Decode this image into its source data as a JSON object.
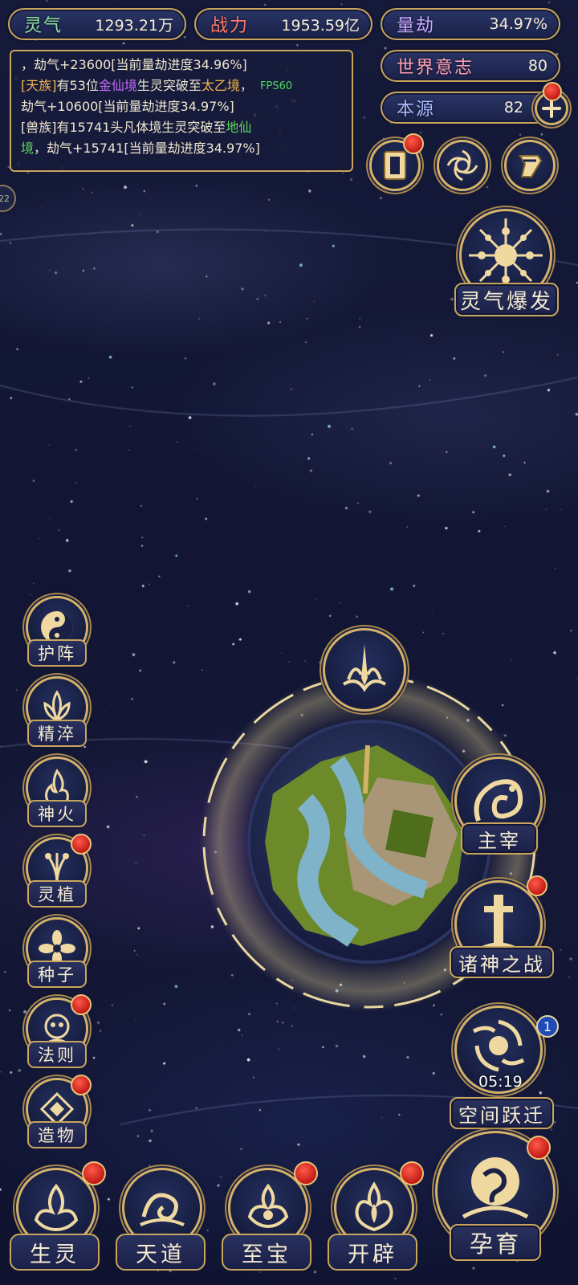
{
  "resources": {
    "qi": {
      "label": "灵气",
      "value": "1293.21万"
    },
    "power": {
      "label": "战力",
      "value": "1953.59亿"
    },
    "kalpa": {
      "label": "量劫",
      "value": "34.97%"
    },
    "world_will": {
      "label": "世界意志",
      "value": "80"
    },
    "origin": {
      "label": "本源",
      "value": "82"
    }
  },
  "log": {
    "line1": "，劫气+23600[当前量劫进度34.96%]",
    "e2_race": "[天族]",
    "e2_a": "有53位",
    "e2_realm": "金仙境",
    "e2_b": "生灵突破至",
    "e2_target": "太乙境",
    "e2_c": "，",
    "e2_d": "劫气+10600[当前量劫进度34.97%]",
    "e3_a": "[兽族]有15741头凡体境生灵突破至",
    "e3_realm": "地仙",
    "e3_realm2": "境",
    "e3_b": "，劫气+15741[当前量劫进度34.97%]",
    "fps": "FPS60",
    "side_tab": "22"
  },
  "top_icons": [
    "card-icon",
    "vortex-icon",
    "scroll-icon"
  ],
  "qi_burst": {
    "label": "灵气爆发"
  },
  "left_menu": [
    {
      "label": "护阵",
      "icon": "yin-yang-icon",
      "dot": false
    },
    {
      "label": "精淬",
      "icon": "lotus-flame-icon",
      "dot": false
    },
    {
      "label": "神火",
      "icon": "divine-fire-icon",
      "dot": false
    },
    {
      "label": "灵植",
      "icon": "spirit-plant-icon",
      "dot": true
    },
    {
      "label": "种子",
      "icon": "seed-flower-icon",
      "dot": false
    },
    {
      "label": "法则",
      "icon": "law-beast-icon",
      "dot": true
    },
    {
      "label": "造物",
      "icon": "creation-diamond-icon",
      "dot": true
    }
  ],
  "right_menu": {
    "ruler": {
      "label": "主宰"
    },
    "gods_war": {
      "label": "诸神之战"
    },
    "space_jump": {
      "label": "空间跃迁",
      "timer": "05:19",
      "badge": "1"
    }
  },
  "bottom_bar": [
    {
      "label": "生灵",
      "icon": "life-icon"
    },
    {
      "label": "天道",
      "icon": "heaven-way-icon"
    },
    {
      "label": "至宝",
      "icon": "treasure-icon"
    },
    {
      "label": "开辟",
      "icon": "creation-flame-icon"
    }
  ],
  "nurture": {
    "label": "孕育"
  },
  "colors": {
    "gold": "#d4b168",
    "panel": "#1a2148",
    "dot": "#c21b16",
    "water": "#7fb3c9",
    "land_green": "#6c8a2a"
  }
}
